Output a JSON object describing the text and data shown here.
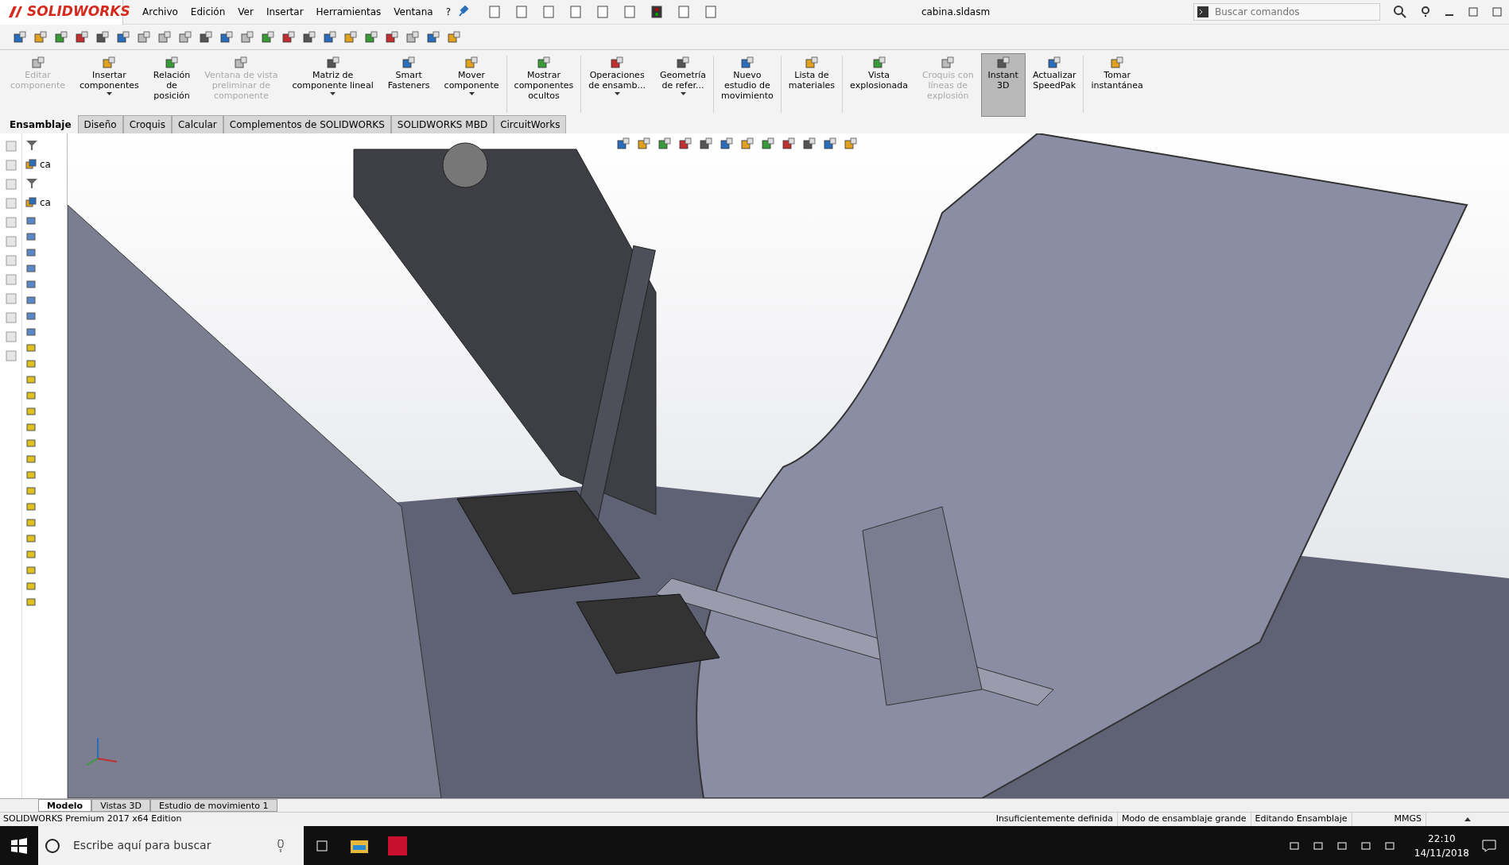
{
  "app": {
    "logo": "SOLIDWORKS",
    "menu": [
      "Archivo",
      "Edición",
      "Ver",
      "Insertar",
      "Herramientas",
      "Ventana",
      "?"
    ],
    "document_title": "cabina.sldasm",
    "search": {
      "placeholder": "Buscar comandos"
    }
  },
  "command_manager": [
    {
      "label": "Editar\ncomponente",
      "disabled": true,
      "dropdown": false,
      "selected": false,
      "separator_after": false
    },
    {
      "label": "Insertar\ncomponentes",
      "disabled": false,
      "dropdown": true,
      "selected": false,
      "separator_after": false
    },
    {
      "label": "Relación\nde\nposición",
      "disabled": false,
      "dropdown": false,
      "selected": false,
      "separator_after": false
    },
    {
      "label": "Ventana de vista\npreliminar de\ncomponente",
      "disabled": true,
      "dropdown": false,
      "selected": false,
      "separator_after": false
    },
    {
      "label": "Matriz de\ncomponente lineal",
      "disabled": false,
      "dropdown": true,
      "selected": false,
      "separator_after": false
    },
    {
      "label": "Smart\nFasteners",
      "disabled": false,
      "dropdown": false,
      "selected": false,
      "separator_after": false
    },
    {
      "label": "Mover\ncomponente",
      "disabled": false,
      "dropdown": true,
      "selected": false,
      "separator_after": true
    },
    {
      "label": "Mostrar\ncomponentes\nocultos",
      "disabled": false,
      "dropdown": false,
      "selected": false,
      "separator_after": true
    },
    {
      "label": "Operaciones\nde ensamb...",
      "disabled": false,
      "dropdown": true,
      "selected": false,
      "separator_after": false
    },
    {
      "label": "Geometría\nde refer...",
      "disabled": false,
      "dropdown": true,
      "selected": false,
      "separator_after": true
    },
    {
      "label": "Nuevo\nestudio de\nmovimiento",
      "disabled": false,
      "dropdown": false,
      "selected": false,
      "separator_after": true
    },
    {
      "label": "Lista de\nmateriales",
      "disabled": false,
      "dropdown": false,
      "selected": false,
      "separator_after": true
    },
    {
      "label": "Vista\nexplosionada",
      "disabled": false,
      "dropdown": false,
      "selected": false,
      "separator_after": false
    },
    {
      "label": "Croquis con\nlíneas de\nexplosión",
      "disabled": true,
      "dropdown": false,
      "selected": false,
      "separator_after": false
    },
    {
      "label": "Instant\n3D",
      "disabled": false,
      "dropdown": false,
      "selected": true,
      "separator_after": false
    },
    {
      "label": "Actualizar\nSpeedPak",
      "disabled": false,
      "dropdown": false,
      "selected": false,
      "separator_after": true
    },
    {
      "label": "Tomar\ninstantánea",
      "disabled": false,
      "dropdown": false,
      "selected": false,
      "separator_after": false
    }
  ],
  "tabs": [
    {
      "label": "Ensamblaje",
      "selected": true
    },
    {
      "label": "Diseño",
      "selected": false
    },
    {
      "label": "Croquis",
      "selected": false
    },
    {
      "label": "Calcular",
      "selected": false
    },
    {
      "label": "Complementos de SOLIDWORKS",
      "selected": false
    },
    {
      "label": "SOLIDWORKS MBD",
      "selected": false
    },
    {
      "label": "CircuitWorks",
      "selected": false
    }
  ],
  "feature_tree": {
    "panes": [
      {
        "item": "ca"
      },
      {
        "item": "ca"
      }
    ]
  },
  "model_tabs": [
    {
      "label": "Modelo",
      "selected": true
    },
    {
      "label": "Vistas 3D",
      "selected": false
    },
    {
      "label": "Estudio de movimiento 1",
      "selected": false
    }
  ],
  "status_bar": {
    "edition": "SOLIDWORKS Premium 2017 x64 Edition",
    "fields": [
      "Insuficientemente definida",
      "Modo de ensamblaje grande",
      "Editando Ensamblaje"
    ],
    "units": "MMGS"
  },
  "taskbar": {
    "search_placeholder": "Escribe aquí para buscar",
    "time": "22:10",
    "date": "14/11/2018"
  }
}
